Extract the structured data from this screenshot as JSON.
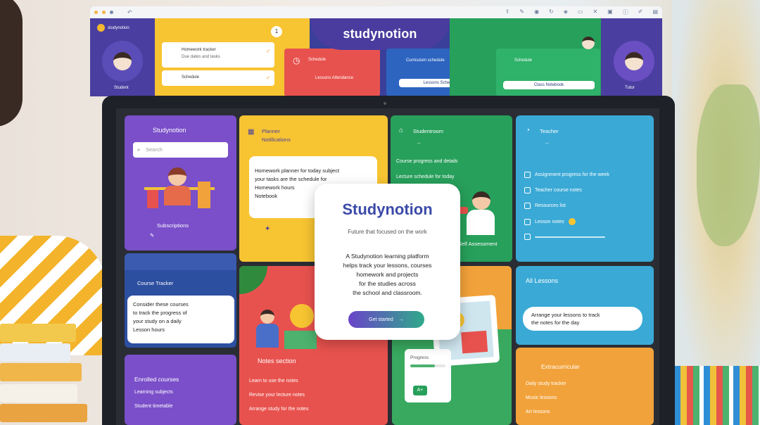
{
  "brand": "studynotion",
  "colors": {
    "purple": "#6c4fc4",
    "yellow": "#f7c432",
    "green": "#27a05b",
    "blue": "#3aa9d6",
    "red": "#e8524e",
    "orange": "#f2a23a",
    "navy": "#2d4fa0"
  },
  "top_window": {
    "logo_text": "studynotion",
    "left_avatar_label": "Student",
    "right_avatar_label": "Tutor",
    "yellow_card": {
      "line1": "Homework tracker",
      "line2": "Due dates and tasks",
      "line3": "Schedule"
    },
    "red_card": {
      "title": "Schedule",
      "sub": "Lessons Attendance"
    },
    "blue_card": {
      "title": "Curriculum schedule",
      "button": "Lessons Schedule"
    },
    "green_card": {
      "title": "Schedule",
      "button": "Class Notebook"
    }
  },
  "tiles": {
    "purple_top": {
      "title": "Studynotion",
      "search_placeholder": "Search",
      "caption": "Subscriptions"
    },
    "yellow_top": {
      "title1": "Planner",
      "title2": "Notifications",
      "body": [
        "Homework planner for today subject",
        "your tasks are the schedule for",
        "Homework hours",
        "Notebook"
      ]
    },
    "green_top": {
      "title": "Studentroom",
      "rows": [
        "Course progress and details",
        "Lecture schedule for today"
      ],
      "caption": "Self Assessment"
    },
    "blue_top": {
      "title": "Teacher",
      "rows": [
        "Assignment progress for the week",
        "Teacher course notes",
        "Resources list",
        "Lesson notes"
      ]
    },
    "navy_mid": {
      "title": "Course Tracker",
      "body": [
        "Consider these courses",
        "to track the progress of",
        "your study on a daily",
        "Lesson hours"
      ]
    },
    "red_mid": {
      "title": "Notes section",
      "rows": [
        "Learn to use the notes",
        "Revise your lecture notes",
        "Arrange study for the notes"
      ]
    },
    "blue_mid": {
      "title": "All Lessons",
      "body": [
        "Arrange your lessons to track",
        "the notes for the day"
      ]
    },
    "purple_bottom": {
      "title": "Enrolled courses",
      "rows": [
        "Learning subjects",
        "Student timetable"
      ]
    },
    "orange_bottom": {
      "title": "Extracurricular",
      "rows": [
        "Daily study tracker",
        "Music lessons",
        "Art lessons"
      ]
    },
    "green_bottom": {
      "card_title": "Progress",
      "card_badge": "A+"
    }
  },
  "modal": {
    "title": "Studynotion",
    "subtitle": "Future that focused on the work",
    "description": [
      "A Studynotion learning platform",
      "helps track your lessons, courses",
      "homework and projects",
      "for the studies across",
      "the school and classroom."
    ],
    "button_label": "Get started",
    "button_arrow": "→"
  },
  "icons": {
    "search": "⌕",
    "arrow": "→",
    "check": "✓",
    "clock": "◷",
    "star": "✦"
  }
}
